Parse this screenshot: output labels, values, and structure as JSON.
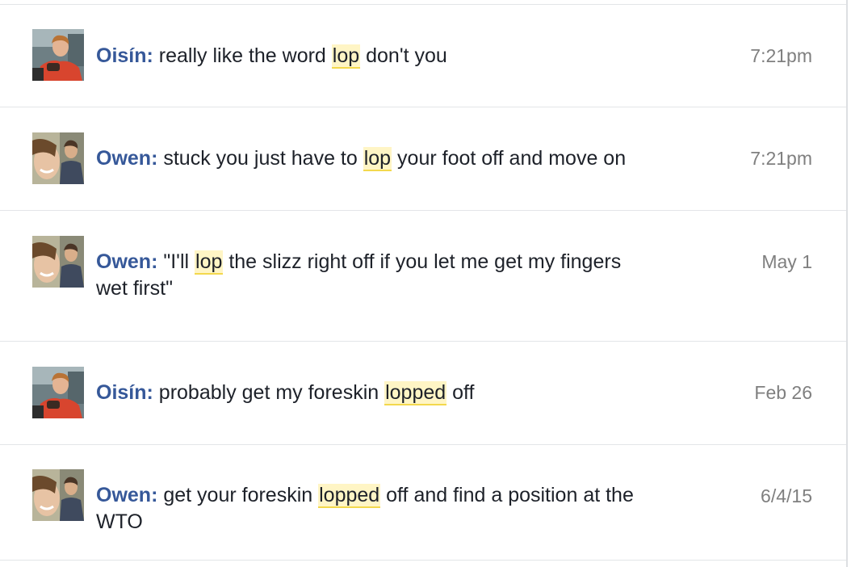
{
  "results": [
    {
      "avatar": "oisin-avatar",
      "sender": "Oisín:",
      "before": "really like the word ",
      "match": "lop",
      "after": " don't you",
      "time": "7:21pm"
    },
    {
      "avatar": "owen-avatar",
      "sender": "Owen:",
      "before": "stuck you just have to ",
      "match": "lop",
      "after": " your foot off and move on",
      "time": "7:21pm"
    },
    {
      "avatar": "owen-avatar",
      "sender": "Owen:",
      "before": "\"I'll ",
      "match": "lop",
      "after": " the slizz right off if you let me get my fingers wet first\"",
      "time": "May 1"
    },
    {
      "avatar": "oisin-avatar",
      "sender": "Oisín:",
      "before": "probably get my foreskin ",
      "match": "lopped",
      "after": " off",
      "time": "Feb 26"
    },
    {
      "avatar": "owen-avatar",
      "sender": "Owen:",
      "before": "get your foreskin ",
      "match": "lopped",
      "after": " off and find a position at the WTO",
      "time": "6/4/15"
    }
  ],
  "colors": {
    "sender": "#365899",
    "highlight_bg": "#fff5c5",
    "highlight_underline": "#f3d84d",
    "timestamp": "#7f7f7f",
    "divider": "#e3e5e8"
  }
}
